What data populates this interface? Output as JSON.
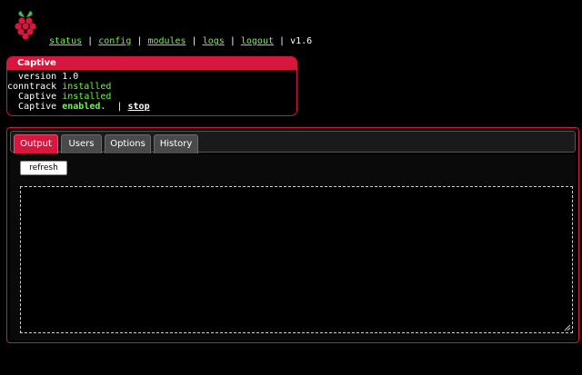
{
  "logo": {
    "icon": "raspberry-logo-icon",
    "color": "#d9163d",
    "leaf_color": "#4caf50"
  },
  "nav": {
    "links": [
      {
        "label": "status"
      },
      {
        "label": "config"
      },
      {
        "label": "modules"
      },
      {
        "label": "logs"
      },
      {
        "label": "logout"
      }
    ],
    "separator": "|",
    "version": "v1.6"
  },
  "module_info": {
    "title": "Captive",
    "version_label": "version",
    "version_value": "1.0",
    "conntrack_label": "conntrack",
    "conntrack_status": "installed",
    "captive_label": "Captive",
    "captive_status": "installed",
    "state_label": "Captive",
    "state_value": "enabled.",
    "pipe": "|",
    "stop_label": "stop"
  },
  "tabs": [
    {
      "label": "Output",
      "active": true
    },
    {
      "label": "Users",
      "active": false
    },
    {
      "label": "Options",
      "active": false
    },
    {
      "label": "History",
      "active": false
    }
  ],
  "content": {
    "refresh_label": "refresh",
    "output_text": ""
  },
  "colors": {
    "accent": "#d9163d",
    "link": "#66ff33",
    "background": "#000000",
    "tab_inactive": "#4a4a4a"
  }
}
